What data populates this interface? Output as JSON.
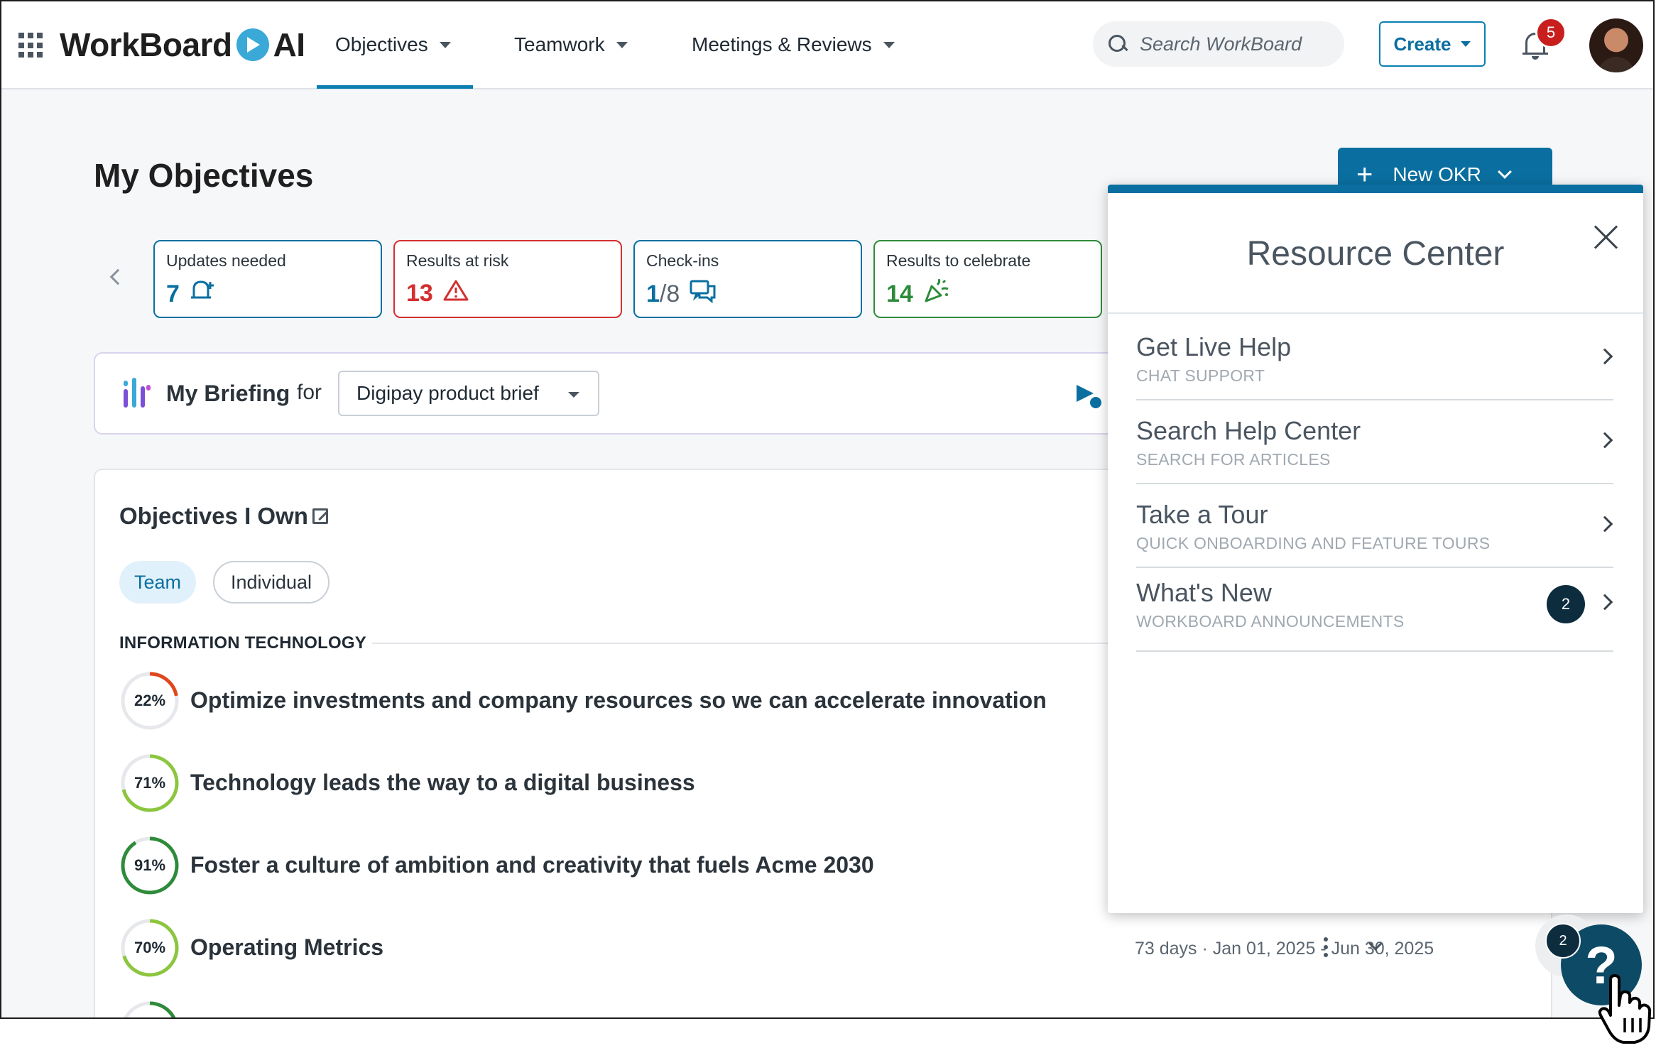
{
  "topbar": {
    "brand_left": "WorkBoard",
    "brand_right": "AI",
    "nav": [
      {
        "label": "Objectives",
        "active": true
      },
      {
        "label": "Teamwork"
      },
      {
        "label": "Meetings & Reviews"
      }
    ],
    "search_placeholder": "Search WorkBoard",
    "create_label": "Create",
    "notifications_count": "5"
  },
  "page": {
    "title": "My Objectives",
    "new_okr_label": "New OKR"
  },
  "stats": [
    {
      "label": "Updates needed",
      "value": "7",
      "color": "#0a6fa0",
      "icon": "bell-plus-icon"
    },
    {
      "label": "Results at risk",
      "value": "13",
      "color": "#d32f2f",
      "icon": "warning-icon"
    },
    {
      "label": "Check-ins",
      "value_main": "1",
      "value_rest": "/8",
      "color": "#0a6fa0",
      "icon": "chat-icon"
    },
    {
      "label": "Results to celebrate",
      "value": "14",
      "color": "#2e8b3a",
      "icon": "party-popper-icon"
    }
  ],
  "briefing": {
    "title": "My Briefing",
    "for_label": "for",
    "selected": "Digipay product brief"
  },
  "objectives": {
    "section_title": "Objectives I Own",
    "filters": [
      "Team",
      "Individual"
    ],
    "active_filter": "Team",
    "group_label": "INFORMATION TECHNOLOGY",
    "rows": [
      {
        "progress": 22,
        "progress_label": "22%",
        "name": "Optimize investments and company resources so we can accelerate innovation",
        "color": "#e0471c"
      },
      {
        "progress": 71,
        "progress_label": "71%",
        "name": "Technology leads the way to a digital business",
        "color": "#8cc63f"
      },
      {
        "progress": 91,
        "progress_label": "91%",
        "name": "Foster a culture of ambition and creativity that fuels Acme 2030",
        "color": "#2e8b3a"
      },
      {
        "progress": 70,
        "progress_label": "70%",
        "name": "Operating Metrics",
        "color": "#8cc63f",
        "days": "73 days",
        "dates": "Jan 01, 2025 - Jun 30, 2025"
      }
    ]
  },
  "resource_center": {
    "title": "Resource Center",
    "items": [
      {
        "title": "Get Live Help",
        "subtitle": "CHAT SUPPORT"
      },
      {
        "title": "Search Help Center",
        "subtitle": "SEARCH FOR ARTICLES"
      },
      {
        "title": "Take a Tour",
        "subtitle": "QUICK ONBOARDING AND FEATURE TOURS"
      },
      {
        "title": "What's New",
        "subtitle": "WORKBOARD ANNOUNCEMENTS",
        "badge": "2"
      }
    ]
  },
  "help": {
    "label": "?",
    "badge": "2"
  }
}
